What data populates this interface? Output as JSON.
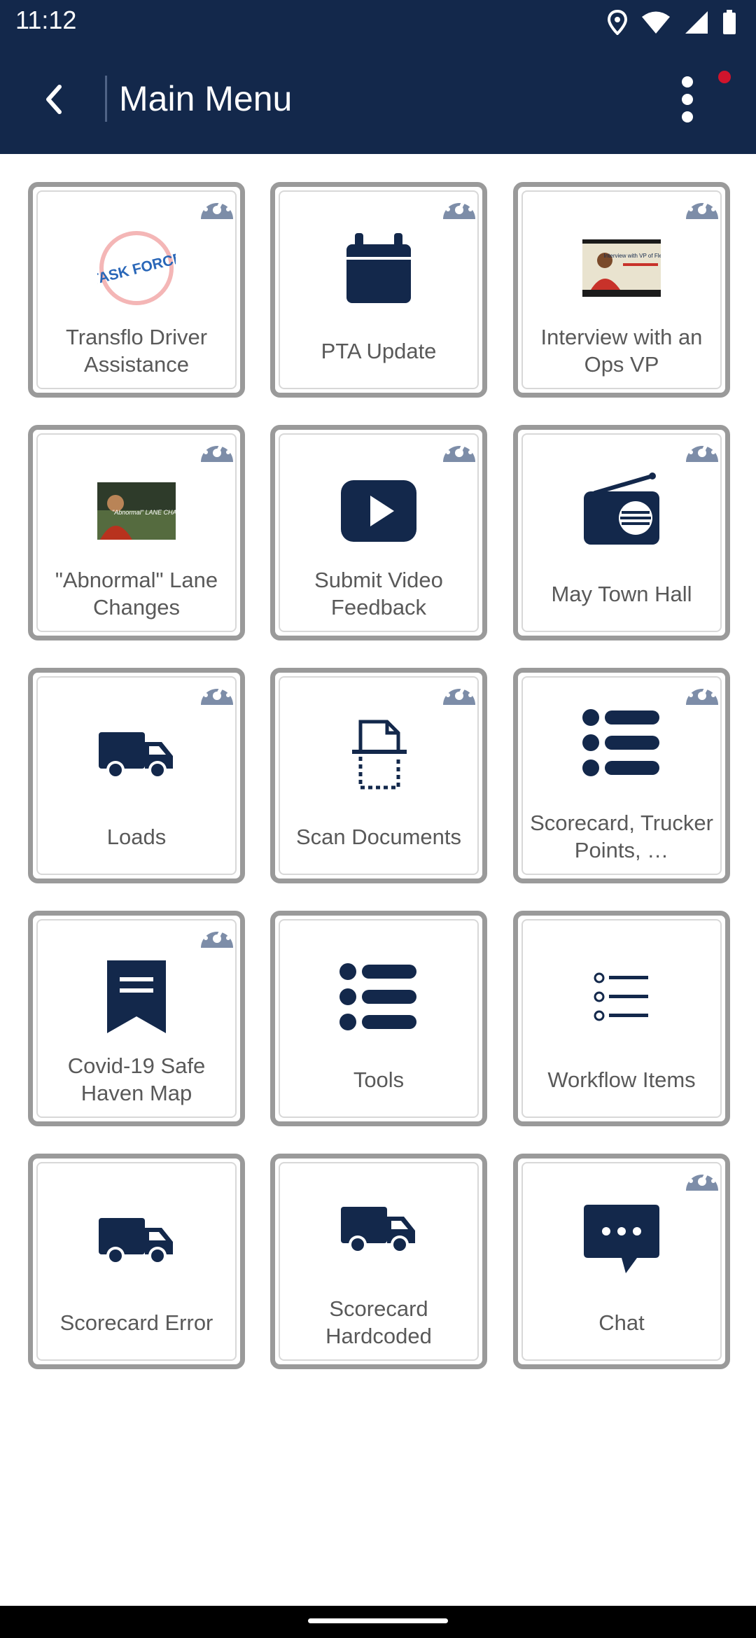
{
  "status_bar": {
    "time": "11:12"
  },
  "app_bar": {
    "title": "Main Menu"
  },
  "colors": {
    "navy": "#13284b",
    "tile_border": "#9a9a9a",
    "label": "#595959",
    "notification": "#d0142c"
  },
  "tiles": [
    {
      "label": "Transflo Driver Assistance",
      "icon": "task-force-logo",
      "gauge": true,
      "logo_text": "TASK FORCE"
    },
    {
      "label": "PTA Update",
      "icon": "calendar-icon",
      "gauge": true
    },
    {
      "label": "Interview with an Ops VP",
      "icon": "video-thumbnail-interview",
      "gauge": true,
      "thumb_text": "Interview with VP of Fleet Ops"
    },
    {
      "label": "\"Abnormal\" Lane Changes",
      "icon": "video-thumbnail-lane-changes",
      "gauge": true,
      "thumb_text": "\"Abnormal\" LANE CHANGES"
    },
    {
      "label": "Submit Video Feedback",
      "icon": "play-video-icon",
      "gauge": true
    },
    {
      "label": "May Town Hall",
      "icon": "radio-icon",
      "gauge": true
    },
    {
      "label": "Loads",
      "icon": "truck-icon",
      "gauge": true
    },
    {
      "label": "Scan Documents",
      "icon": "scan-document-icon",
      "gauge": true
    },
    {
      "label": "Scorecard, Trucker Points, …",
      "icon": "list-icon",
      "gauge": true
    },
    {
      "label": "Covid-19 Safe Haven Map",
      "icon": "bookmark-icon",
      "gauge": true
    },
    {
      "label": "Tools",
      "icon": "list-icon",
      "gauge": false
    },
    {
      "label": "Workflow Items",
      "icon": "checklist-icon",
      "gauge": false
    },
    {
      "label": "Scorecard Error",
      "icon": "truck-icon",
      "gauge": false
    },
    {
      "label": "Scorecard Hardcoded",
      "icon": "truck-icon",
      "gauge": false
    },
    {
      "label": "Chat",
      "icon": "chat-icon",
      "gauge": true
    }
  ]
}
